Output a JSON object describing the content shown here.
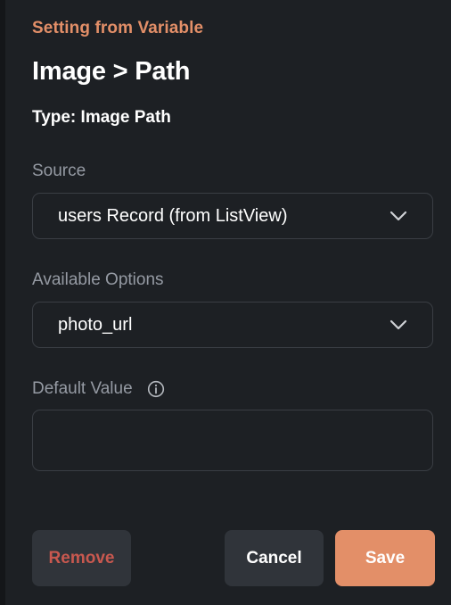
{
  "header": {
    "eyebrow": "Setting from Variable",
    "title": "Image > Path",
    "type_line": "Type: Image Path"
  },
  "source": {
    "label": "Source",
    "value": "users Record (from ListView)"
  },
  "options": {
    "label": "Available Options",
    "value": "photo_url"
  },
  "default_value": {
    "label": "Default Value",
    "value": "",
    "icon": "info-icon"
  },
  "buttons": {
    "remove": "Remove",
    "cancel": "Cancel",
    "save": "Save"
  },
  "colors": {
    "accent": "#e38f68",
    "danger": "#c8584f",
    "panel_bg": "#1d2024"
  }
}
